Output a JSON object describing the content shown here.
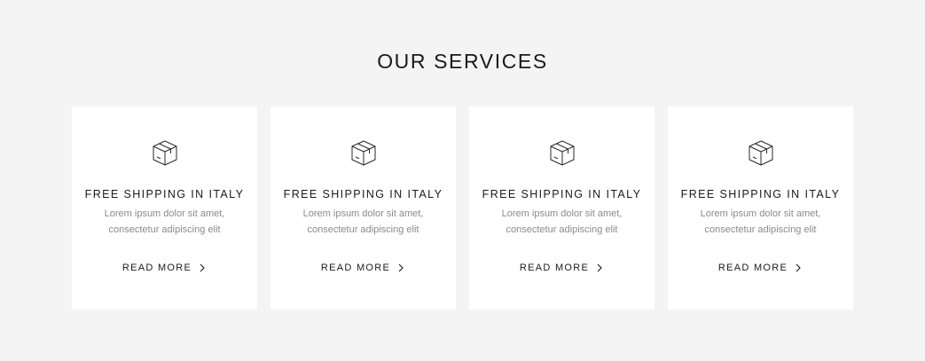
{
  "section": {
    "title": "OUR SERVICES"
  },
  "cards": [
    {
      "icon": "box-icon",
      "title": "FREE SHIPPING IN ITALY",
      "desc_line1": "Lorem ipsum dolor sit amet,",
      "desc_line2": "consectetur adipiscing elit",
      "link_label": "READ MORE"
    },
    {
      "icon": "box-icon",
      "title": "FREE SHIPPING IN ITALY",
      "desc_line1": "Lorem ipsum dolor sit amet,",
      "desc_line2": "consectetur adipiscing elit",
      "link_label": "READ MORE"
    },
    {
      "icon": "box-icon",
      "title": "FREE SHIPPING IN ITALY",
      "desc_line1": "Lorem ipsum dolor sit amet,",
      "desc_line2": "consectetur adipiscing elit",
      "link_label": "READ MORE"
    },
    {
      "icon": "box-icon",
      "title": "FREE SHIPPING IN ITALY",
      "desc_line1": "Lorem ipsum dolor sit amet,",
      "desc_line2": "consectetur adipiscing elit",
      "link_label": "READ MORE"
    }
  ],
  "colors": {
    "background": "#f4f4f4",
    "card": "#ffffff",
    "text": "#1a1a1a",
    "muted": "#8a8a8a"
  }
}
